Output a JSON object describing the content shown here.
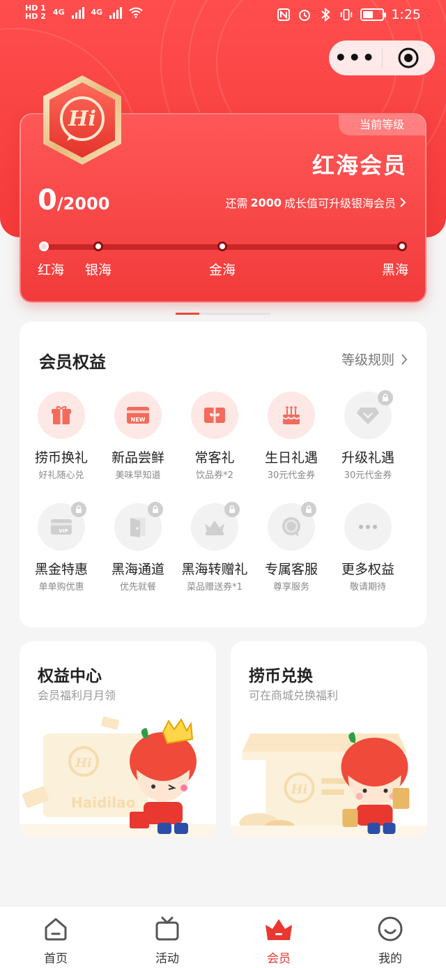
{
  "status_bar": {
    "sim1": "HD 1",
    "sim2": "HD 2",
    "net1": "4G",
    "net2": "4G",
    "time": "1:25"
  },
  "capsule": {
    "more_label": "•••"
  },
  "member_card": {
    "badge_text": "Hi",
    "level_tag": "当前等级",
    "level_name": "红海会员",
    "points_current": "0",
    "points_total": "/2000",
    "upgrade_prefix": "还需",
    "upgrade_amount": "2000",
    "upgrade_suffix": "成长值可升级银海会员",
    "progress": 0,
    "tiers": [
      "红海",
      "银海",
      "金海",
      "黑海"
    ]
  },
  "benefits": {
    "title": "会员权益",
    "rules_label": "等级规则",
    "items": [
      {
        "name": "捞币换礼",
        "sub": "好礼随心兑",
        "icon": "gift-icon",
        "locked": false
      },
      {
        "name": "新品尝鲜",
        "sub": "美味早知道",
        "icon": "new-card-icon",
        "locked": false
      },
      {
        "name": "常客礼",
        "sub": "饮品券*2",
        "icon": "coupon-icon",
        "locked": false
      },
      {
        "name": "生日礼遇",
        "sub": "30元代金券",
        "icon": "cake-icon",
        "locked": false
      },
      {
        "name": "升级礼遇",
        "sub": "30元代金券",
        "icon": "diamond-icon",
        "locked": true
      },
      {
        "name": "黑金特惠",
        "sub": "单单购优惠",
        "icon": "vip-card-icon",
        "locked": true
      },
      {
        "name": "黑海通道",
        "sub": "优先就餐",
        "icon": "door-icon",
        "locked": true
      },
      {
        "name": "黑海转赠礼",
        "sub": "菜品赠送券*1",
        "icon": "crown-gift-icon",
        "locked": true
      },
      {
        "name": "专属客服",
        "sub": "尊享服务",
        "icon": "service-icon",
        "locked": true
      },
      {
        "name": "更多权益",
        "sub": "敬请期待",
        "icon": "more-icon",
        "locked": false
      }
    ]
  },
  "promos": [
    {
      "title": "权益中心",
      "sub": "会员福利月月领",
      "art_text": "Haidilao"
    },
    {
      "title": "捞币兑换",
      "sub": "可在商城兑换福利"
    }
  ],
  "tabbar": {
    "items": [
      {
        "label": "首页",
        "icon": "home-icon"
      },
      {
        "label": "活动",
        "icon": "activity-tv-icon"
      },
      {
        "label": "会员",
        "icon": "member-crown-icon"
      },
      {
        "label": "我的",
        "icon": "profile-smile-icon"
      }
    ],
    "active_index": 2
  },
  "colors": {
    "brand_red": "#f43a3a",
    "active_tab": "#e8382f"
  }
}
